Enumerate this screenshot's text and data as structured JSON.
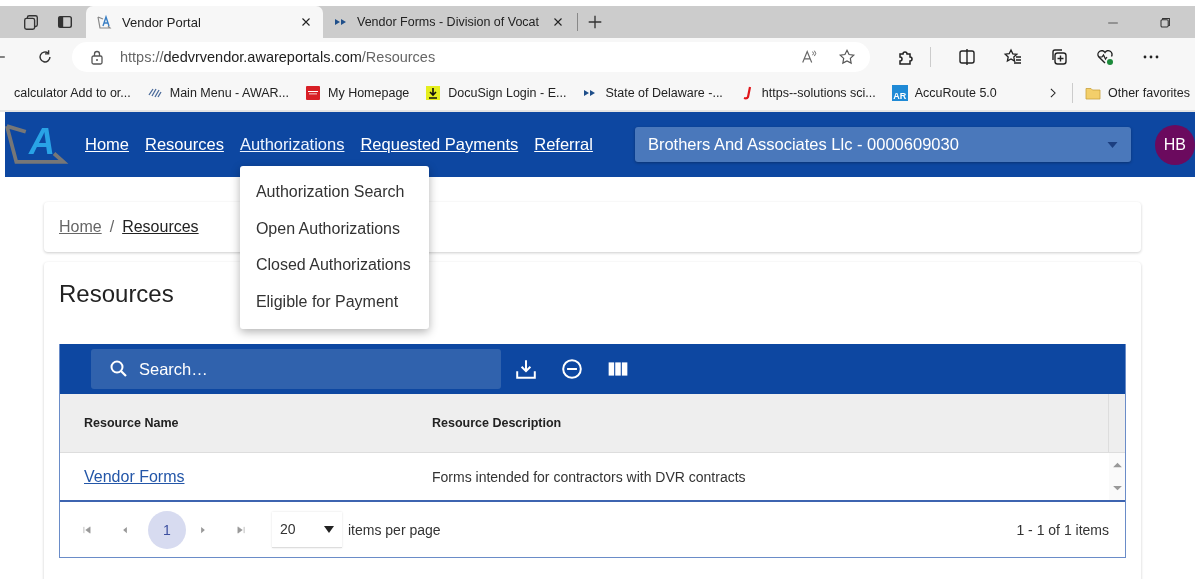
{
  "browser": {
    "tabs": [
      {
        "title": "Vendor Portal",
        "selected": true
      },
      {
        "title": "Vendor Forms - Division of Vocat",
        "selected": false
      }
    ],
    "url": {
      "scheme": "https://",
      "host": "dedvrvendor.awareportals.com",
      "path": "/Resources"
    },
    "bookmarks": [
      {
        "label": "calculator Add to or..."
      },
      {
        "label": "Main Menu - AWAR..."
      },
      {
        "label": "My Homepage"
      },
      {
        "label": "DocuSign Login - E..."
      },
      {
        "label": "State of Delaware -..."
      },
      {
        "label": "https--solutions sci..."
      },
      {
        "label": "AccuRoute 5.0",
        "badge": "AR"
      }
    ],
    "other_favorites": "Other favorites"
  },
  "app": {
    "logo_letter": "A",
    "nav": [
      {
        "label": "Home",
        "open": false
      },
      {
        "label": "Resources",
        "open": false
      },
      {
        "label": "Authorizations",
        "open": true
      },
      {
        "label": "Requested Payments",
        "open": false
      },
      {
        "label": "Referral",
        "open": false
      }
    ],
    "menu": [
      "Authorization Search",
      "Open Authorizations",
      "Closed Authorizations",
      "Eligible for Payment"
    ],
    "vendor_select": "Brothers And Associates Llc - 0000609030",
    "avatar": {
      "initials": "HB",
      "color": "#6b0a5e"
    }
  },
  "breadcrumb": [
    {
      "label": "Home",
      "current": false
    },
    {
      "label": "Resources",
      "current": true
    }
  ],
  "breadcrumb_separator": "/",
  "page_title": "Resources",
  "grid": {
    "search": {
      "placeholder": "Search…"
    },
    "columns": [
      "Resource Name",
      "Resource Description"
    ],
    "rows": [
      {
        "name": "Vendor Forms",
        "description": "Forms intended for contractors with DVR contracts"
      }
    ],
    "pager": {
      "pages": [
        {
          "label": "1",
          "selected": true
        }
      ],
      "page_size": "20",
      "page_size_label": "items per page",
      "summary": "1 - 1 of 1 items"
    }
  }
}
